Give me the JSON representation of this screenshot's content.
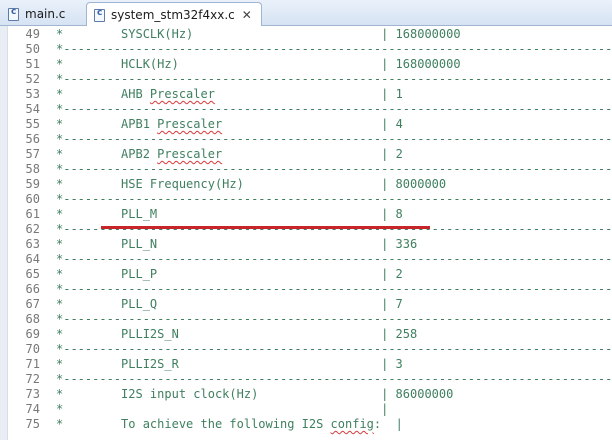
{
  "tabs": [
    {
      "label": "main.c"
    },
    {
      "label": "system_stm32f4xx.c"
    }
  ],
  "lines": [
    {
      "num": "49",
      "pre": "*        SYSCLK(Hz)                          | 168000000"
    },
    {
      "num": "50",
      "pre": "*-----------------------------------------------------------------------------"
    },
    {
      "num": "51",
      "pre": "*        HCLK(Hz)                            | 168000000"
    },
    {
      "num": "52",
      "pre": "*-----------------------------------------------------------------------------"
    },
    {
      "num": "53",
      "pre": "*        AHB ",
      "sq": "Prescaler",
      "post": "                       | 1"
    },
    {
      "num": "54",
      "pre": "*-----------------------------------------------------------------------------"
    },
    {
      "num": "55",
      "pre": "*        APB1 ",
      "sq": "Prescaler",
      "post": "                      | 4"
    },
    {
      "num": "56",
      "pre": "*-----------------------------------------------------------------------------"
    },
    {
      "num": "57",
      "pre": "*        APB2 ",
      "sq": "Prescaler",
      "post": "                      | 2"
    },
    {
      "num": "58",
      "pre": "*-----------------------------------------------------------------------------"
    },
    {
      "num": "59",
      "pre": "*        HSE Frequency(Hz)                   | 8000000"
    },
    {
      "num": "60",
      "pre": "*-----------------------------------------------------------------------------"
    },
    {
      "num": "61",
      "pre": "*        PLL_M                               | 8"
    },
    {
      "num": "62",
      "pre": "*-----------------------------------------------------------------------------"
    },
    {
      "num": "63",
      "pre": "*        PLL_N                               | 336"
    },
    {
      "num": "64",
      "pre": "*-----------------------------------------------------------------------------"
    },
    {
      "num": "65",
      "pre": "*        PLL_P                               | 2"
    },
    {
      "num": "66",
      "pre": "*-----------------------------------------------------------------------------"
    },
    {
      "num": "67",
      "pre": "*        PLL_Q                               | 7"
    },
    {
      "num": "68",
      "pre": "*-----------------------------------------------------------------------------"
    },
    {
      "num": "69",
      "pre": "*        PLLI2S_N                            | 258"
    },
    {
      "num": "70",
      "pre": "*-----------------------------------------------------------------------------"
    },
    {
      "num": "71",
      "pre": "*        PLLI2S_R                            | 3"
    },
    {
      "num": "72",
      "pre": "*-----------------------------------------------------------------------------"
    },
    {
      "num": "73",
      "pre": "*        I2S input clock(Hz)                 | 86000000"
    },
    {
      "num": "74",
      "pre": "*                                            |"
    },
    {
      "num": "75",
      "pre": "*        To achieve the following I2S ",
      "sq": "config",
      "post": ":  |"
    }
  ],
  "colors": {
    "comment": "#3f7f5f",
    "line_number": "#787878",
    "highlight_mark": "#c8252b"
  },
  "icons": {
    "tab_file": "c-source-file-icon",
    "tab_close": "close-icon"
  }
}
